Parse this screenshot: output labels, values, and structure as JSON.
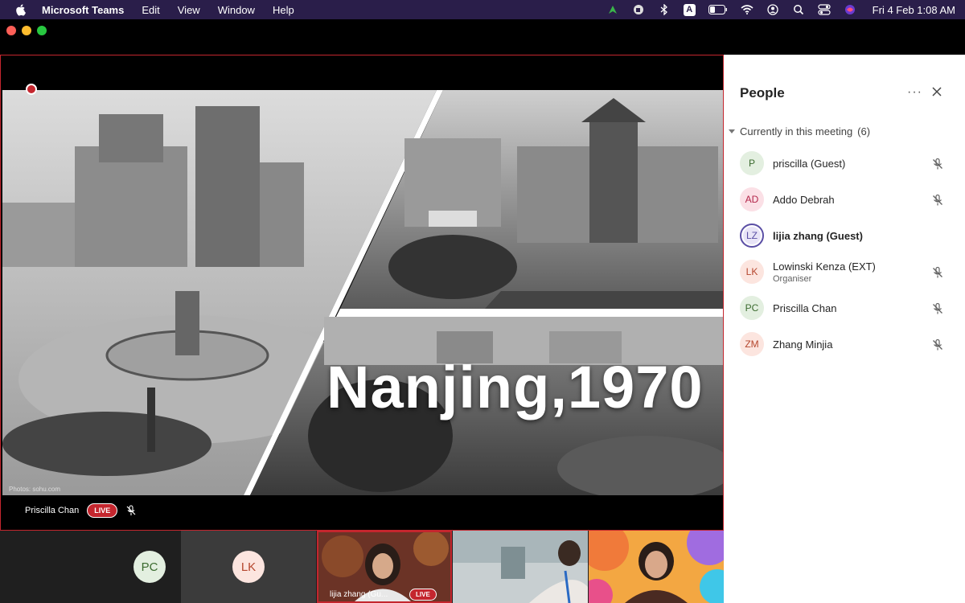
{
  "menubar": {
    "app_name": "Microsoft Teams",
    "items": [
      "Edit",
      "View",
      "Window",
      "Help"
    ],
    "clock": "Fri 4 Feb  1:08 AM",
    "input_letter": "A"
  },
  "stage": {
    "slide_title": "Nanjing,1970",
    "photo_credit": "Photos: sohu.com",
    "speaker_name": "Priscilla Chan",
    "live_label": "LIVE"
  },
  "thumbnails": {
    "t1_initials": "PC",
    "t2_initials": "LK",
    "t3_label": "lijia zhang (Gu...",
    "t3_live": "LIVE"
  },
  "panel": {
    "title": "People",
    "section_label": "Currently in this meeting",
    "section_count": "(6)",
    "people": [
      {
        "initials": "P",
        "name": "priscilla (Guest)",
        "role": "",
        "color": "#e3efe0",
        "text_color": "#3b6b2f",
        "muted": true,
        "bold": false
      },
      {
        "initials": "AD",
        "name": "Addo Debrah",
        "role": "",
        "color": "#fbe0e6",
        "text_color": "#b3264a",
        "muted": true,
        "bold": false
      },
      {
        "initials": "LZ",
        "name": "lijia zhang (Guest)",
        "role": "",
        "color": "#e8e4f7",
        "text_color": "#5b4fa5",
        "muted": false,
        "bold": true
      },
      {
        "initials": "LK",
        "name": "Lowinski Kenza (EXT)",
        "role": "Organiser",
        "color": "#fce5df",
        "text_color": "#b5472e",
        "muted": true,
        "bold": false
      },
      {
        "initials": "PC",
        "name": "Priscilla Chan",
        "role": "",
        "color": "#e3efe0",
        "text_color": "#3b6b2f",
        "muted": true,
        "bold": false
      },
      {
        "initials": "ZM",
        "name": "Zhang Minjia",
        "role": "",
        "color": "#fce5df",
        "text_color": "#b5472e",
        "muted": true,
        "bold": false
      }
    ]
  },
  "colors": {
    "accent_red": "#c4262e",
    "menubar_bg": "#2a1e4a"
  },
  "icons": [
    "apple-icon",
    "mic-off-icon",
    "more-icon",
    "close-icon",
    "wifi-icon",
    "bluetooth-icon",
    "battery-icon",
    "search-icon",
    "control-center-icon"
  ]
}
